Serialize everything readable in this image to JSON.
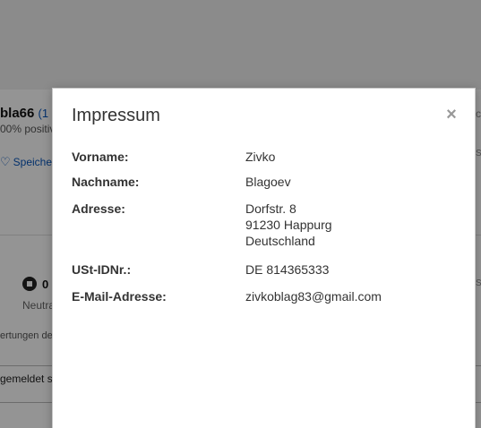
{
  "background": {
    "seller_name": "bla66",
    "seller_count": "(1",
    "seller_positive": "00% positiv",
    "save_link": "Speiche",
    "neutral_count": "0",
    "neutral_label": "Neutra",
    "ratings_text": "ertungen der",
    "reported_text": "gemeldet s",
    "edge_c": "c",
    "edge_s1": "S",
    "edge_s2": "S"
  },
  "dialog": {
    "title": "Impressum",
    "close_label": "×",
    "fields": [
      {
        "label": "Vorname:",
        "value_lines": [
          "Zivko"
        ]
      },
      {
        "label": "Nachname:",
        "value_lines": [
          "Blagoev"
        ]
      },
      {
        "label": "Adresse:",
        "value_lines": [
          "Dorfstr. 8",
          "91230 Happurg",
          "Deutschland"
        ]
      },
      {
        "label": "USt-IDNr.:",
        "value_lines": [
          "DE 814365333"
        ]
      },
      {
        "label": "E-Mail-Adresse:",
        "value_lines": [
          "zivkoblag83@gmail.com"
        ]
      }
    ]
  },
  "colors": {
    "link_blue": "#0654ba",
    "overlay": "rgba(0,0,0,0.42)",
    "text": "#333333"
  }
}
